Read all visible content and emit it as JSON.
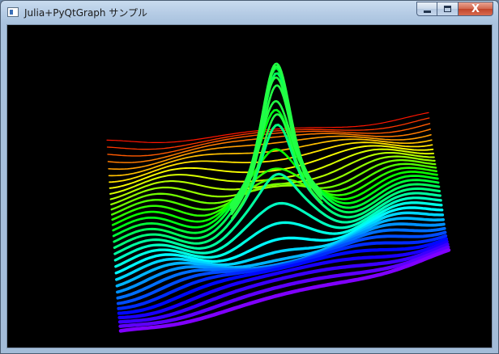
{
  "window": {
    "title": "Julia+PyQtGraph サンプル",
    "icon": "app-window-icon",
    "controls": [
      {
        "name": "minimize-button",
        "icon": "minimize-icon"
      },
      {
        "name": "maximize-button",
        "icon": "maximize-icon"
      },
      {
        "name": "close-button",
        "icon": "close-icon",
        "symbol": "X"
      }
    ]
  },
  "viewport": {
    "background": "#000000",
    "content": "3d-surface-plot",
    "colormap": "rainbow (purple → blue → cyan → green → yellow → red)"
  }
}
